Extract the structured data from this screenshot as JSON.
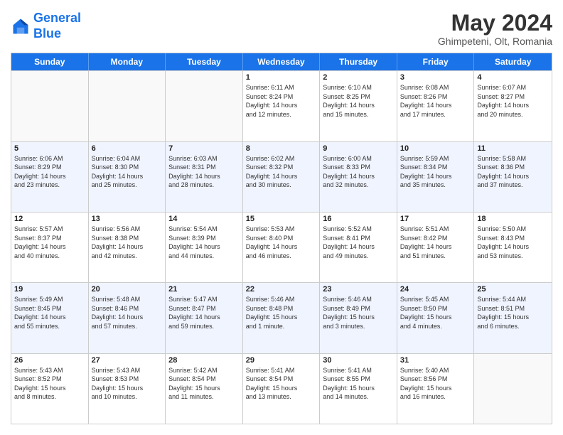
{
  "header": {
    "logo_general": "General",
    "logo_blue": "Blue",
    "title": "May 2024",
    "subtitle": "Ghimpeteni, Olt, Romania"
  },
  "calendar": {
    "days_of_week": [
      "Sunday",
      "Monday",
      "Tuesday",
      "Wednesday",
      "Thursday",
      "Friday",
      "Saturday"
    ],
    "weeks": [
      {
        "alt": false,
        "cells": [
          {
            "day": "",
            "info": ""
          },
          {
            "day": "",
            "info": ""
          },
          {
            "day": "",
            "info": ""
          },
          {
            "day": "1",
            "info": "Sunrise: 6:11 AM\nSunset: 8:24 PM\nDaylight: 14 hours\nand 12 minutes."
          },
          {
            "day": "2",
            "info": "Sunrise: 6:10 AM\nSunset: 8:25 PM\nDaylight: 14 hours\nand 15 minutes."
          },
          {
            "day": "3",
            "info": "Sunrise: 6:08 AM\nSunset: 8:26 PM\nDaylight: 14 hours\nand 17 minutes."
          },
          {
            "day": "4",
            "info": "Sunrise: 6:07 AM\nSunset: 8:27 PM\nDaylight: 14 hours\nand 20 minutes."
          }
        ]
      },
      {
        "alt": true,
        "cells": [
          {
            "day": "5",
            "info": "Sunrise: 6:06 AM\nSunset: 8:29 PM\nDaylight: 14 hours\nand 23 minutes."
          },
          {
            "day": "6",
            "info": "Sunrise: 6:04 AM\nSunset: 8:30 PM\nDaylight: 14 hours\nand 25 minutes."
          },
          {
            "day": "7",
            "info": "Sunrise: 6:03 AM\nSunset: 8:31 PM\nDaylight: 14 hours\nand 28 minutes."
          },
          {
            "day": "8",
            "info": "Sunrise: 6:02 AM\nSunset: 8:32 PM\nDaylight: 14 hours\nand 30 minutes."
          },
          {
            "day": "9",
            "info": "Sunrise: 6:00 AM\nSunset: 8:33 PM\nDaylight: 14 hours\nand 32 minutes."
          },
          {
            "day": "10",
            "info": "Sunrise: 5:59 AM\nSunset: 8:34 PM\nDaylight: 14 hours\nand 35 minutes."
          },
          {
            "day": "11",
            "info": "Sunrise: 5:58 AM\nSunset: 8:36 PM\nDaylight: 14 hours\nand 37 minutes."
          }
        ]
      },
      {
        "alt": false,
        "cells": [
          {
            "day": "12",
            "info": "Sunrise: 5:57 AM\nSunset: 8:37 PM\nDaylight: 14 hours\nand 40 minutes."
          },
          {
            "day": "13",
            "info": "Sunrise: 5:56 AM\nSunset: 8:38 PM\nDaylight: 14 hours\nand 42 minutes."
          },
          {
            "day": "14",
            "info": "Sunrise: 5:54 AM\nSunset: 8:39 PM\nDaylight: 14 hours\nand 44 minutes."
          },
          {
            "day": "15",
            "info": "Sunrise: 5:53 AM\nSunset: 8:40 PM\nDaylight: 14 hours\nand 46 minutes."
          },
          {
            "day": "16",
            "info": "Sunrise: 5:52 AM\nSunset: 8:41 PM\nDaylight: 14 hours\nand 49 minutes."
          },
          {
            "day": "17",
            "info": "Sunrise: 5:51 AM\nSunset: 8:42 PM\nDaylight: 14 hours\nand 51 minutes."
          },
          {
            "day": "18",
            "info": "Sunrise: 5:50 AM\nSunset: 8:43 PM\nDaylight: 14 hours\nand 53 minutes."
          }
        ]
      },
      {
        "alt": true,
        "cells": [
          {
            "day": "19",
            "info": "Sunrise: 5:49 AM\nSunset: 8:45 PM\nDaylight: 14 hours\nand 55 minutes."
          },
          {
            "day": "20",
            "info": "Sunrise: 5:48 AM\nSunset: 8:46 PM\nDaylight: 14 hours\nand 57 minutes."
          },
          {
            "day": "21",
            "info": "Sunrise: 5:47 AM\nSunset: 8:47 PM\nDaylight: 14 hours\nand 59 minutes."
          },
          {
            "day": "22",
            "info": "Sunrise: 5:46 AM\nSunset: 8:48 PM\nDaylight: 15 hours\nand 1 minute."
          },
          {
            "day": "23",
            "info": "Sunrise: 5:46 AM\nSunset: 8:49 PM\nDaylight: 15 hours\nand 3 minutes."
          },
          {
            "day": "24",
            "info": "Sunrise: 5:45 AM\nSunset: 8:50 PM\nDaylight: 15 hours\nand 4 minutes."
          },
          {
            "day": "25",
            "info": "Sunrise: 5:44 AM\nSunset: 8:51 PM\nDaylight: 15 hours\nand 6 minutes."
          }
        ]
      },
      {
        "alt": false,
        "cells": [
          {
            "day": "26",
            "info": "Sunrise: 5:43 AM\nSunset: 8:52 PM\nDaylight: 15 hours\nand 8 minutes."
          },
          {
            "day": "27",
            "info": "Sunrise: 5:43 AM\nSunset: 8:53 PM\nDaylight: 15 hours\nand 10 minutes."
          },
          {
            "day": "28",
            "info": "Sunrise: 5:42 AM\nSunset: 8:54 PM\nDaylight: 15 hours\nand 11 minutes."
          },
          {
            "day": "29",
            "info": "Sunrise: 5:41 AM\nSunset: 8:54 PM\nDaylight: 15 hours\nand 13 minutes."
          },
          {
            "day": "30",
            "info": "Sunrise: 5:41 AM\nSunset: 8:55 PM\nDaylight: 15 hours\nand 14 minutes."
          },
          {
            "day": "31",
            "info": "Sunrise: 5:40 AM\nSunset: 8:56 PM\nDaylight: 15 hours\nand 16 minutes."
          },
          {
            "day": "",
            "info": ""
          }
        ]
      }
    ]
  }
}
